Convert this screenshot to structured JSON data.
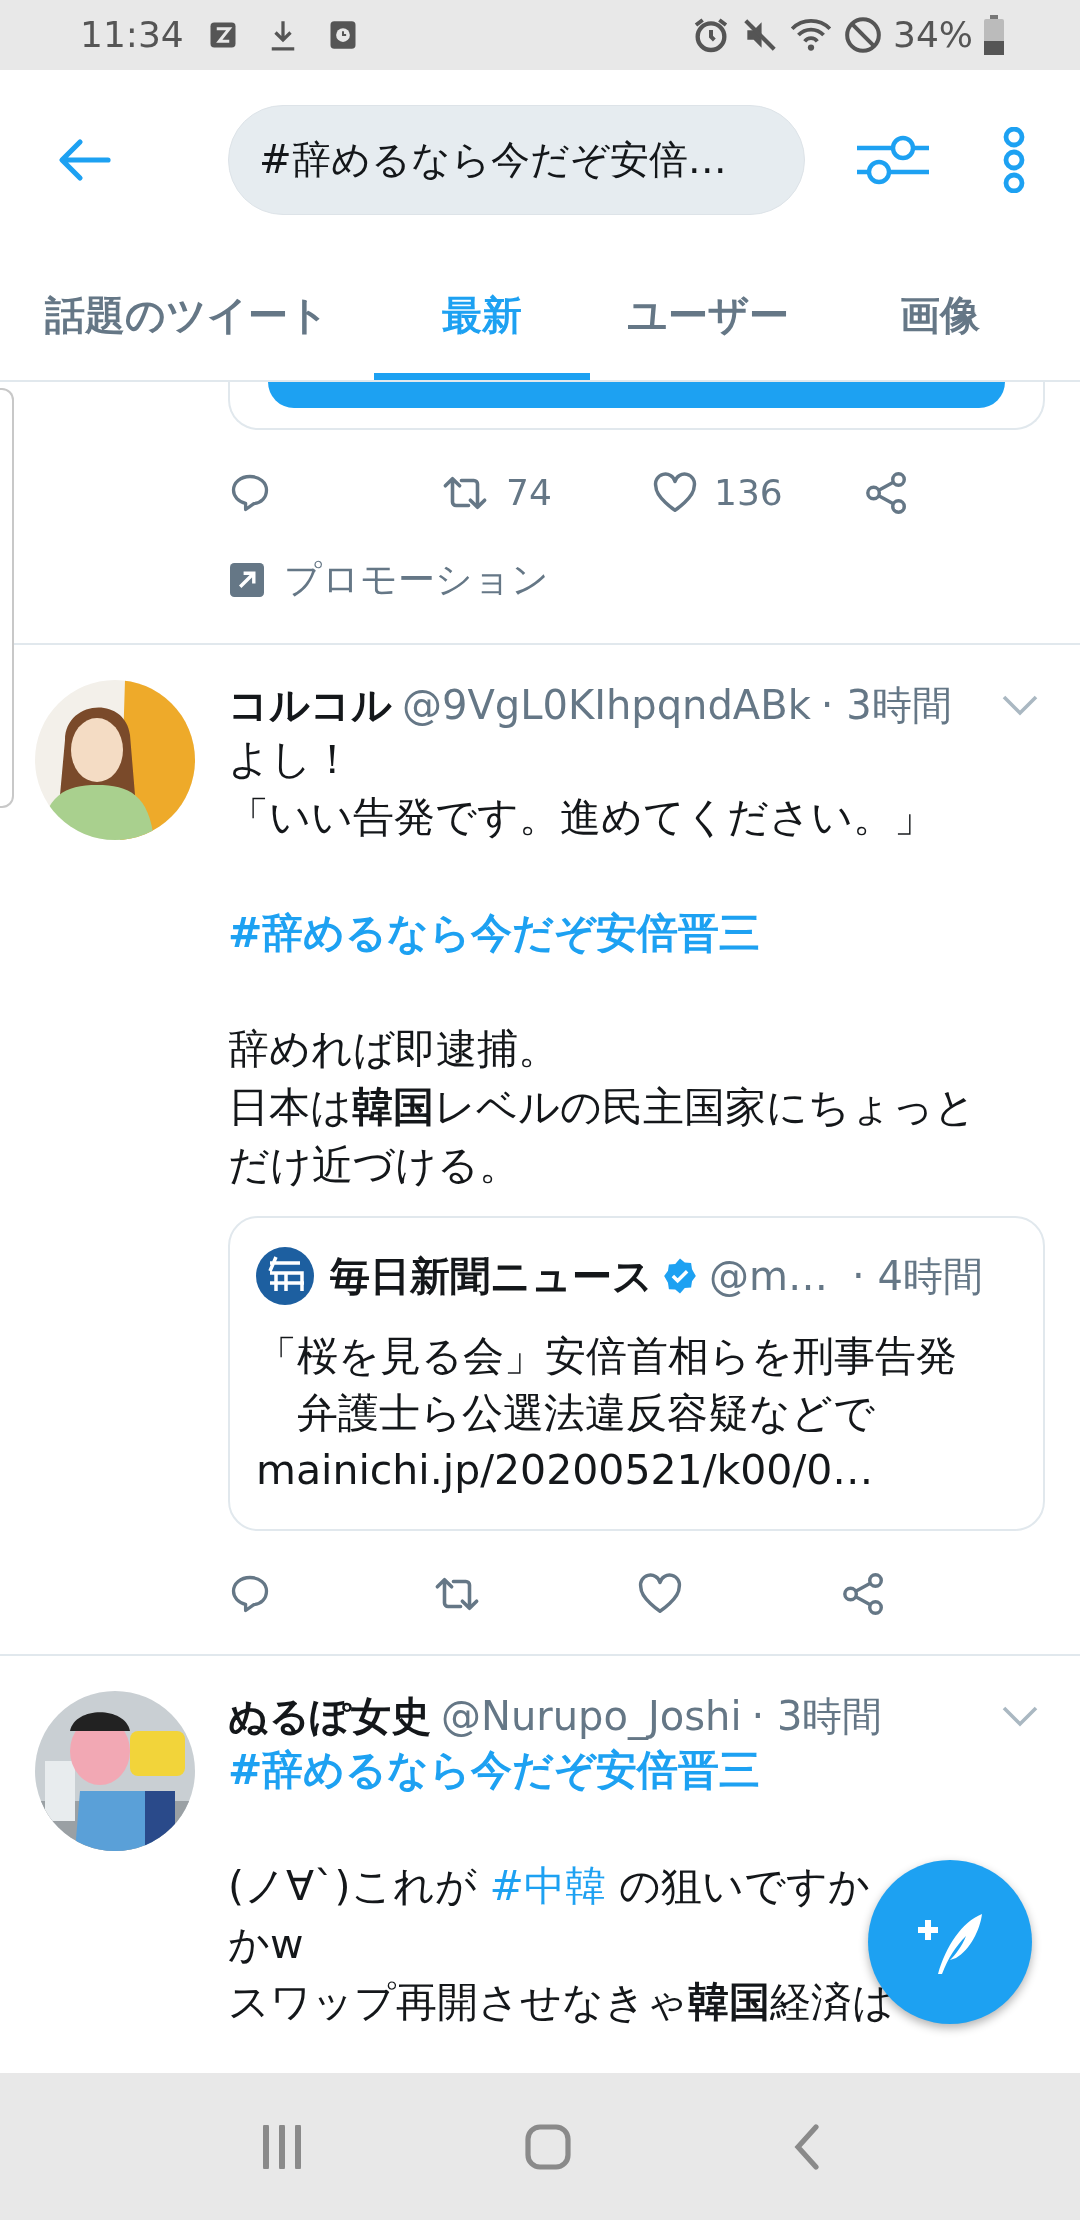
{
  "status_bar": {
    "time": "11:34",
    "battery": "34%"
  },
  "search": {
    "value": "#辞めるなら今だぞ安倍…"
  },
  "tabs": [
    {
      "label": "話題のツイート",
      "selected": false
    },
    {
      "label": "最新",
      "selected": true
    },
    {
      "label": "ユーザー",
      "selected": false
    },
    {
      "label": "画像",
      "selected": false
    }
  ],
  "promoted": {
    "retweets": "74",
    "likes": "136",
    "label": "プロモーション"
  },
  "tweets": [
    {
      "name": "コルコル",
      "handle": "@9VgL0KIhpqndABk",
      "time": "· 3時間",
      "paragraphs": [
        {
          "kind": "text",
          "lines": [
            [
              {
                "kind": "text",
                "text": "よし！"
              }
            ],
            [
              {
                "kind": "text",
                "text": "「いい告発です。進めてください。」"
              }
            ]
          ]
        },
        {
          "kind": "hashtag",
          "text": "#辞めるなら今だぞ安倍晋三"
        },
        {
          "kind": "text",
          "lines": [
            [
              {
                "kind": "text",
                "text": "辞めれば即逮捕。"
              }
            ],
            [
              {
                "kind": "text",
                "text": "日本は**韓国**レベルの民主国家にちょっと"
              }
            ],
            [
              {
                "kind": "text",
                "text": "だけ近づける。"
              }
            ]
          ]
        }
      ],
      "quote": {
        "name": "毎日新聞ニュース",
        "verified": true,
        "handle": "@m…",
        "time": "· 4時間",
        "lines": [
          "「桜を見る会」安倍首相らを刑事告発",
          "　弁護士ら公選法違反容疑などで",
          "mainichi.jp/20200521/k00/0…"
        ]
      }
    },
    {
      "name": "ぬるぽ女史",
      "handle": "@Nurupo_Joshi",
      "time": "· 3時間",
      "paragraphs": [
        {
          "kind": "hashtag",
          "text": "#辞めるなら今だぞ安倍晋三"
        },
        {
          "kind": "text",
          "lines": [
            [
              {
                "kind": "text",
                "text": "(ノ∀`)これが "
              },
              {
                "kind": "tag",
                "text": "#中韓"
              },
              {
                "kind": "text",
                "text": " の狙いですか"
              }
            ],
            [
              {
                "kind": "text",
                "text": "かw"
              }
            ],
            [
              {
                "kind": "text",
                "text": "スワップ再開させなきゃ**韓国**経済は"
              }
            ]
          ]
        }
      ]
    }
  ]
}
